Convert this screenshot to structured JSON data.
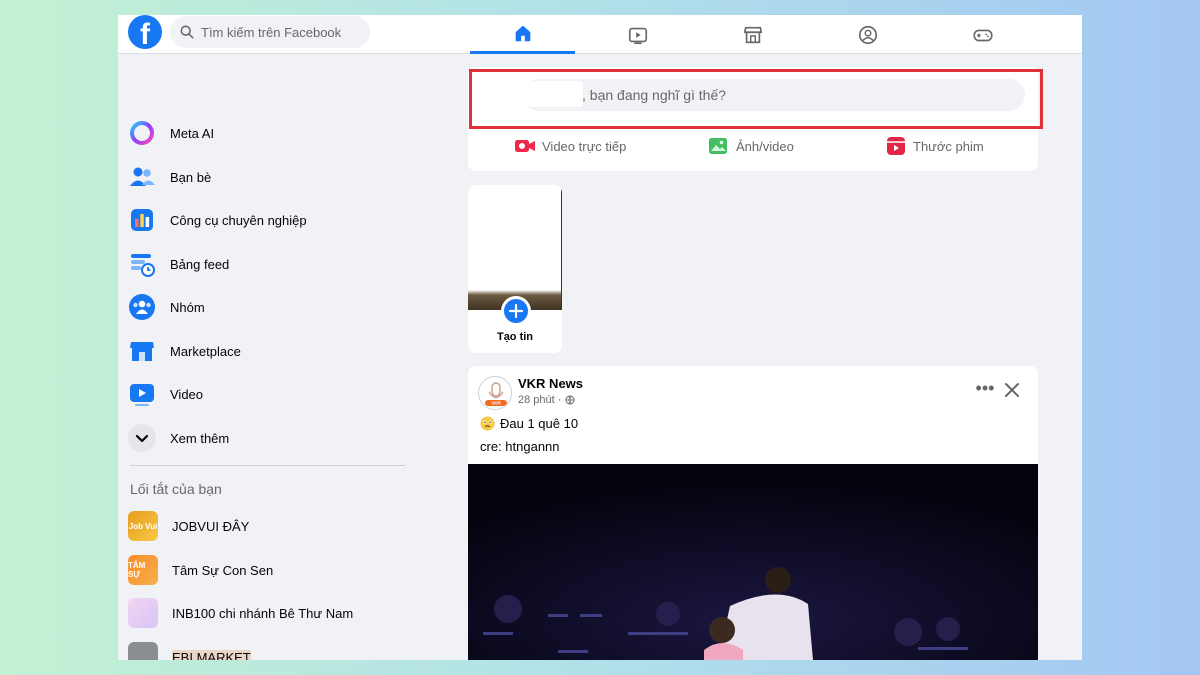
{
  "header": {
    "search_placeholder": "Tìm kiếm trên Facebook",
    "nav_tabs": [
      {
        "name": "home",
        "icon": "home-icon",
        "active": true
      },
      {
        "name": "video",
        "icon": "video-play-icon",
        "active": false
      },
      {
        "name": "marketplace",
        "icon": "marketplace-store-icon",
        "active": false
      },
      {
        "name": "groups",
        "icon": "groups-icon",
        "active": false
      },
      {
        "name": "gaming",
        "icon": "gamepad-icon",
        "active": false
      }
    ]
  },
  "sidebar": {
    "items": [
      {
        "label": "Meta AI",
        "icon": "meta-ai-icon"
      },
      {
        "label": "Bạn bè",
        "icon": "friends-icon"
      },
      {
        "label": "Công cụ chuyên nghiệp",
        "icon": "professional-tools-icon"
      },
      {
        "label": "Bảng feed",
        "icon": "feeds-icon"
      },
      {
        "label": "Nhóm",
        "icon": "groups-icon"
      },
      {
        "label": "Marketplace",
        "icon": "marketplace-icon"
      },
      {
        "label": "Video",
        "icon": "video-icon"
      },
      {
        "label": "Xem thêm",
        "icon": "chevron-down-icon"
      }
    ],
    "shortcuts_title": "Lối tắt của bạn",
    "shortcuts": [
      {
        "label": "JOBVUI ĐÂY",
        "thumb_text": "Job Vui"
      },
      {
        "label": "Tâm Sự Con Sen",
        "thumb_text": "TÂM SỰ"
      },
      {
        "label": "INB100 chi nhánh Bê Thư Nam",
        "thumb_text": ""
      },
      {
        "label": "EBI MARKET",
        "thumb_text": ""
      }
    ]
  },
  "composer": {
    "prompt": ", bạn đang nghĩ gì thế?",
    "actions": [
      {
        "label": "Video trực tiếp",
        "icon": "live-video-icon"
      },
      {
        "label": "Ảnh/video",
        "icon": "photo-video-icon"
      },
      {
        "label": "Thước phim",
        "icon": "reels-icon"
      }
    ]
  },
  "story": {
    "create_label": "Tạo tin"
  },
  "post": {
    "author": "VKR News",
    "time": "28 phút ·",
    "avatar_text": "VKR",
    "text_line1": "Đau 1 quê 10",
    "text_line2": "cre: htngannn",
    "more_label": "•••"
  },
  "colors": {
    "brand_blue": "#1877f2",
    "highlight_red": "#e0313b",
    "live_red": "#f02849",
    "photo_green": "#45bd62",
    "reels_pink": "#e42645"
  }
}
